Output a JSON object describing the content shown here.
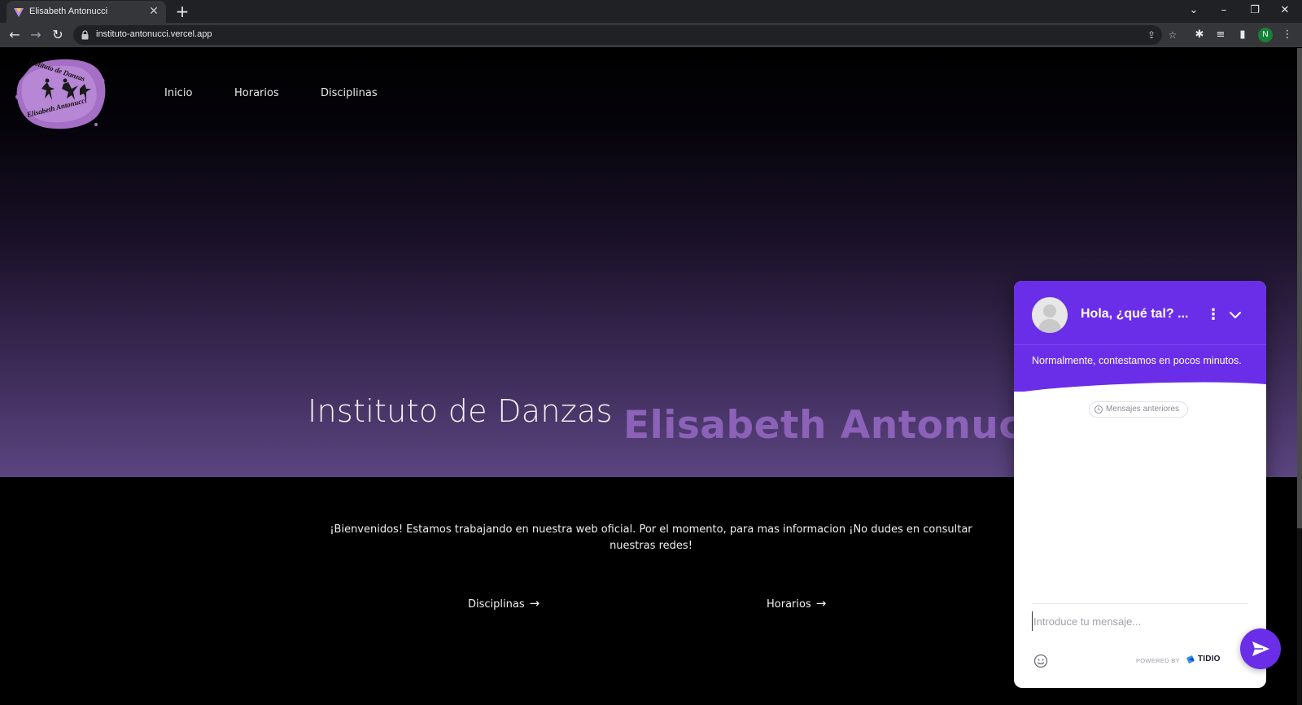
{
  "browser": {
    "tab_title": "Elisabeth Antonucci",
    "url": "instituto-antonucci.vercel.app",
    "profile_initial": "N"
  },
  "site": {
    "logo_text_top": "Instituto de Danzas",
    "logo_text_bottom": "Elisabeth Antonucci",
    "nav": [
      {
        "label": "Inicio"
      },
      {
        "label": "Horarios"
      },
      {
        "label": "Disciplinas"
      }
    ],
    "hero_title": "Instituto de Danzas",
    "hero_accent": "Elisabeth Antonucci",
    "welcome": "¡Bienvenidos! Estamos trabajando en nuestra web oficial. Por el momento, para mas informacion ¡No dudes en consultar nuestras redes!",
    "cta": [
      {
        "label": "Disciplinas",
        "arrow": "→"
      },
      {
        "label": "Horarios",
        "arrow": "→"
      }
    ]
  },
  "chat": {
    "title": "Hola, ¿qué tal? ...",
    "subtitle": "Normalmente, contestamos en pocos minutos.",
    "previous_messages": "Mensajes anteriores",
    "input_placeholder": "Introduce tu mensaje...",
    "powered_by": "POWERED BY",
    "brand": "TIDIO"
  },
  "colors": {
    "accent_purple": "#8b62b8",
    "chat_purple": "#6a2ee8"
  }
}
